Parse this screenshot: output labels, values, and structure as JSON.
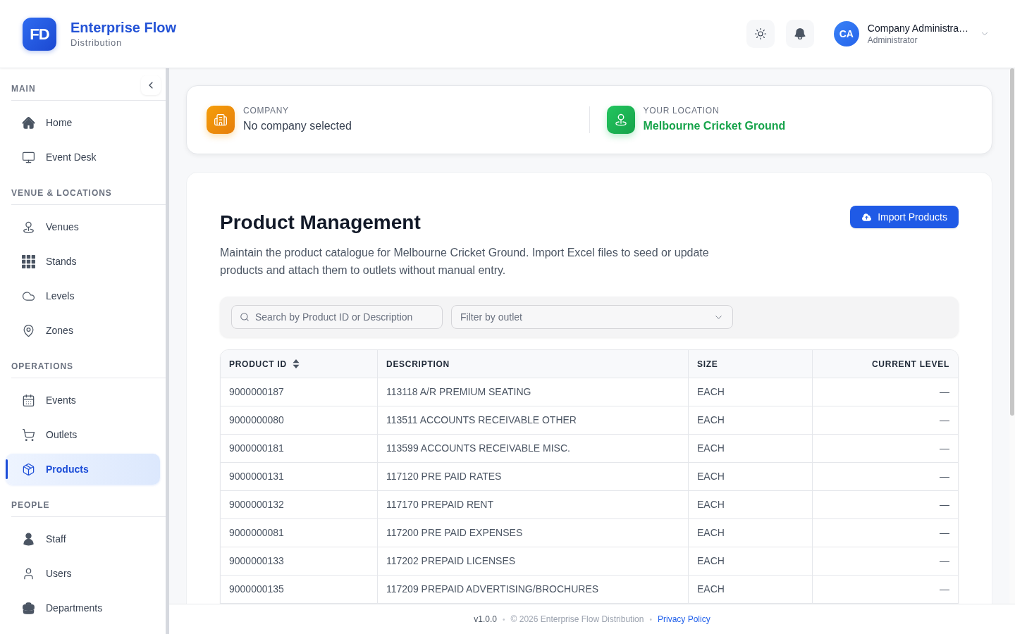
{
  "header": {
    "logo_text": "FD",
    "title": "Enterprise Flow",
    "subtitle": "Distribution",
    "user": {
      "initials": "CA",
      "name": "Company Administra…",
      "role": "Administrator"
    }
  },
  "sidebar": {
    "sections": [
      {
        "label": "MAIN",
        "items": [
          {
            "label": "Home",
            "selected": false
          },
          {
            "label": "Event Desk",
            "selected": false
          }
        ]
      },
      {
        "label": "VENUE & LOCATIONS",
        "items": [
          {
            "label": "Venues",
            "selected": false
          },
          {
            "label": "Stands",
            "selected": false
          },
          {
            "label": "Levels",
            "selected": false
          },
          {
            "label": "Zones",
            "selected": false
          }
        ]
      },
      {
        "label": "OPERATIONS",
        "items": [
          {
            "label": "Events",
            "selected": false
          },
          {
            "label": "Outlets",
            "selected": false
          },
          {
            "label": "Products",
            "selected": true
          }
        ]
      },
      {
        "label": "PEOPLE",
        "items": [
          {
            "label": "Staff",
            "selected": false
          },
          {
            "label": "Users",
            "selected": false
          },
          {
            "label": "Departments",
            "selected": false
          }
        ]
      }
    ]
  },
  "context_bar": {
    "company": {
      "label": "COMPANY",
      "value": "No company selected"
    },
    "location": {
      "label": "YOUR LOCATION",
      "value": "Melbourne Cricket Ground"
    }
  },
  "page": {
    "title": "Product Management",
    "description": "Maintain the product catalogue for Melbourne Cricket Ground. Import Excel files to seed or update products and attach them to outlets without manual entry.",
    "import_button": "Import Products",
    "search": {
      "placeholder": "Search by Product ID or Description"
    },
    "outlet_filter": {
      "placeholder": "Filter by outlet"
    },
    "table": {
      "columns": [
        {
          "label": "PRODUCT ID",
          "sortable": true
        },
        {
          "label": "DESCRIPTION",
          "sortable": false
        },
        {
          "label": "SIZE",
          "sortable": false
        },
        {
          "label": "CURRENT LEVEL",
          "sortable": false
        }
      ],
      "rows": [
        [
          "9000000187",
          "113118 A/R PREMIUM SEATING",
          "EACH",
          "—"
        ],
        [
          "9000000080",
          "113511 ACCOUNTS RECEIVABLE OTHER",
          "EACH",
          "—"
        ],
        [
          "9000000181",
          "113599 ACCOUNTS RECEIVABLE MISC.",
          "EACH",
          "—"
        ],
        [
          "9000000131",
          "117120 PRE PAID RATES",
          "EACH",
          "—"
        ],
        [
          "9000000132",
          "117170 PREPAID RENT",
          "EACH",
          "—"
        ],
        [
          "9000000081",
          "117200 PRE PAID EXPENSES",
          "EACH",
          "—"
        ],
        [
          "9000000133",
          "117202 PREPAID LICENSES",
          "EACH",
          "—"
        ],
        [
          "9000000135",
          "117209 PREPAID ADVERTISING/BROCHURES",
          "EACH",
          "—"
        ]
      ]
    }
  },
  "footer": {
    "items": [
      {
        "kind": "version",
        "text": "v1.0.0"
      },
      {
        "kind": "separator",
        "text": "•"
      },
      {
        "kind": "text",
        "text": "© 2026 Enterprise Flow Distribution"
      },
      {
        "kind": "separator",
        "text": "•"
      },
      {
        "kind": "link",
        "text": "Privacy Policy"
      }
    ]
  }
}
